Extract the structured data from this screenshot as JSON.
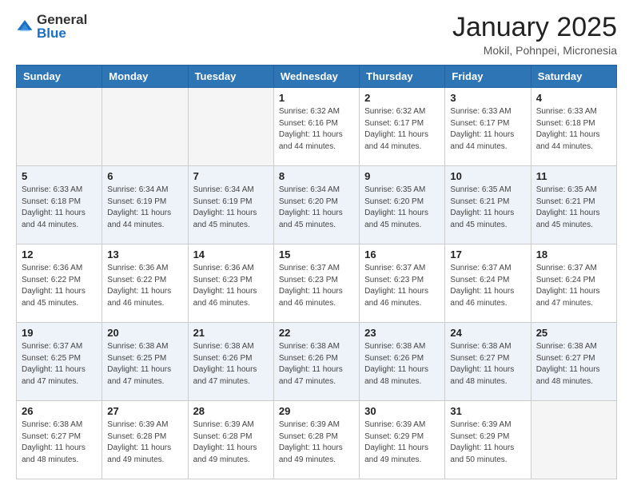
{
  "logo": {
    "general": "General",
    "blue": "Blue"
  },
  "title": "January 2025",
  "location": "Mokil, Pohnpei, Micronesia",
  "days_of_week": [
    "Sunday",
    "Monday",
    "Tuesday",
    "Wednesday",
    "Thursday",
    "Friday",
    "Saturday"
  ],
  "weeks": [
    [
      {
        "day": "",
        "info": ""
      },
      {
        "day": "",
        "info": ""
      },
      {
        "day": "",
        "info": ""
      },
      {
        "day": "1",
        "info": "Sunrise: 6:32 AM\nSunset: 6:16 PM\nDaylight: 11 hours and 44 minutes."
      },
      {
        "day": "2",
        "info": "Sunrise: 6:32 AM\nSunset: 6:17 PM\nDaylight: 11 hours and 44 minutes."
      },
      {
        "day": "3",
        "info": "Sunrise: 6:33 AM\nSunset: 6:17 PM\nDaylight: 11 hours and 44 minutes."
      },
      {
        "day": "4",
        "info": "Sunrise: 6:33 AM\nSunset: 6:18 PM\nDaylight: 11 hours and 44 minutes."
      }
    ],
    [
      {
        "day": "5",
        "info": "Sunrise: 6:33 AM\nSunset: 6:18 PM\nDaylight: 11 hours and 44 minutes."
      },
      {
        "day": "6",
        "info": "Sunrise: 6:34 AM\nSunset: 6:19 PM\nDaylight: 11 hours and 44 minutes."
      },
      {
        "day": "7",
        "info": "Sunrise: 6:34 AM\nSunset: 6:19 PM\nDaylight: 11 hours and 45 minutes."
      },
      {
        "day": "8",
        "info": "Sunrise: 6:34 AM\nSunset: 6:20 PM\nDaylight: 11 hours and 45 minutes."
      },
      {
        "day": "9",
        "info": "Sunrise: 6:35 AM\nSunset: 6:20 PM\nDaylight: 11 hours and 45 minutes."
      },
      {
        "day": "10",
        "info": "Sunrise: 6:35 AM\nSunset: 6:21 PM\nDaylight: 11 hours and 45 minutes."
      },
      {
        "day": "11",
        "info": "Sunrise: 6:35 AM\nSunset: 6:21 PM\nDaylight: 11 hours and 45 minutes."
      }
    ],
    [
      {
        "day": "12",
        "info": "Sunrise: 6:36 AM\nSunset: 6:22 PM\nDaylight: 11 hours and 45 minutes."
      },
      {
        "day": "13",
        "info": "Sunrise: 6:36 AM\nSunset: 6:22 PM\nDaylight: 11 hours and 46 minutes."
      },
      {
        "day": "14",
        "info": "Sunrise: 6:36 AM\nSunset: 6:23 PM\nDaylight: 11 hours and 46 minutes."
      },
      {
        "day": "15",
        "info": "Sunrise: 6:37 AM\nSunset: 6:23 PM\nDaylight: 11 hours and 46 minutes."
      },
      {
        "day": "16",
        "info": "Sunrise: 6:37 AM\nSunset: 6:23 PM\nDaylight: 11 hours and 46 minutes."
      },
      {
        "day": "17",
        "info": "Sunrise: 6:37 AM\nSunset: 6:24 PM\nDaylight: 11 hours and 46 minutes."
      },
      {
        "day": "18",
        "info": "Sunrise: 6:37 AM\nSunset: 6:24 PM\nDaylight: 11 hours and 47 minutes."
      }
    ],
    [
      {
        "day": "19",
        "info": "Sunrise: 6:37 AM\nSunset: 6:25 PM\nDaylight: 11 hours and 47 minutes."
      },
      {
        "day": "20",
        "info": "Sunrise: 6:38 AM\nSunset: 6:25 PM\nDaylight: 11 hours and 47 minutes."
      },
      {
        "day": "21",
        "info": "Sunrise: 6:38 AM\nSunset: 6:26 PM\nDaylight: 11 hours and 47 minutes."
      },
      {
        "day": "22",
        "info": "Sunrise: 6:38 AM\nSunset: 6:26 PM\nDaylight: 11 hours and 47 minutes."
      },
      {
        "day": "23",
        "info": "Sunrise: 6:38 AM\nSunset: 6:26 PM\nDaylight: 11 hours and 48 minutes."
      },
      {
        "day": "24",
        "info": "Sunrise: 6:38 AM\nSunset: 6:27 PM\nDaylight: 11 hours and 48 minutes."
      },
      {
        "day": "25",
        "info": "Sunrise: 6:38 AM\nSunset: 6:27 PM\nDaylight: 11 hours and 48 minutes."
      }
    ],
    [
      {
        "day": "26",
        "info": "Sunrise: 6:38 AM\nSunset: 6:27 PM\nDaylight: 11 hours and 48 minutes."
      },
      {
        "day": "27",
        "info": "Sunrise: 6:39 AM\nSunset: 6:28 PM\nDaylight: 11 hours and 49 minutes."
      },
      {
        "day": "28",
        "info": "Sunrise: 6:39 AM\nSunset: 6:28 PM\nDaylight: 11 hours and 49 minutes."
      },
      {
        "day": "29",
        "info": "Sunrise: 6:39 AM\nSunset: 6:28 PM\nDaylight: 11 hours and 49 minutes."
      },
      {
        "day": "30",
        "info": "Sunrise: 6:39 AM\nSunset: 6:29 PM\nDaylight: 11 hours and 49 minutes."
      },
      {
        "day": "31",
        "info": "Sunrise: 6:39 AM\nSunset: 6:29 PM\nDaylight: 11 hours and 50 minutes."
      },
      {
        "day": "",
        "info": ""
      }
    ]
  ]
}
